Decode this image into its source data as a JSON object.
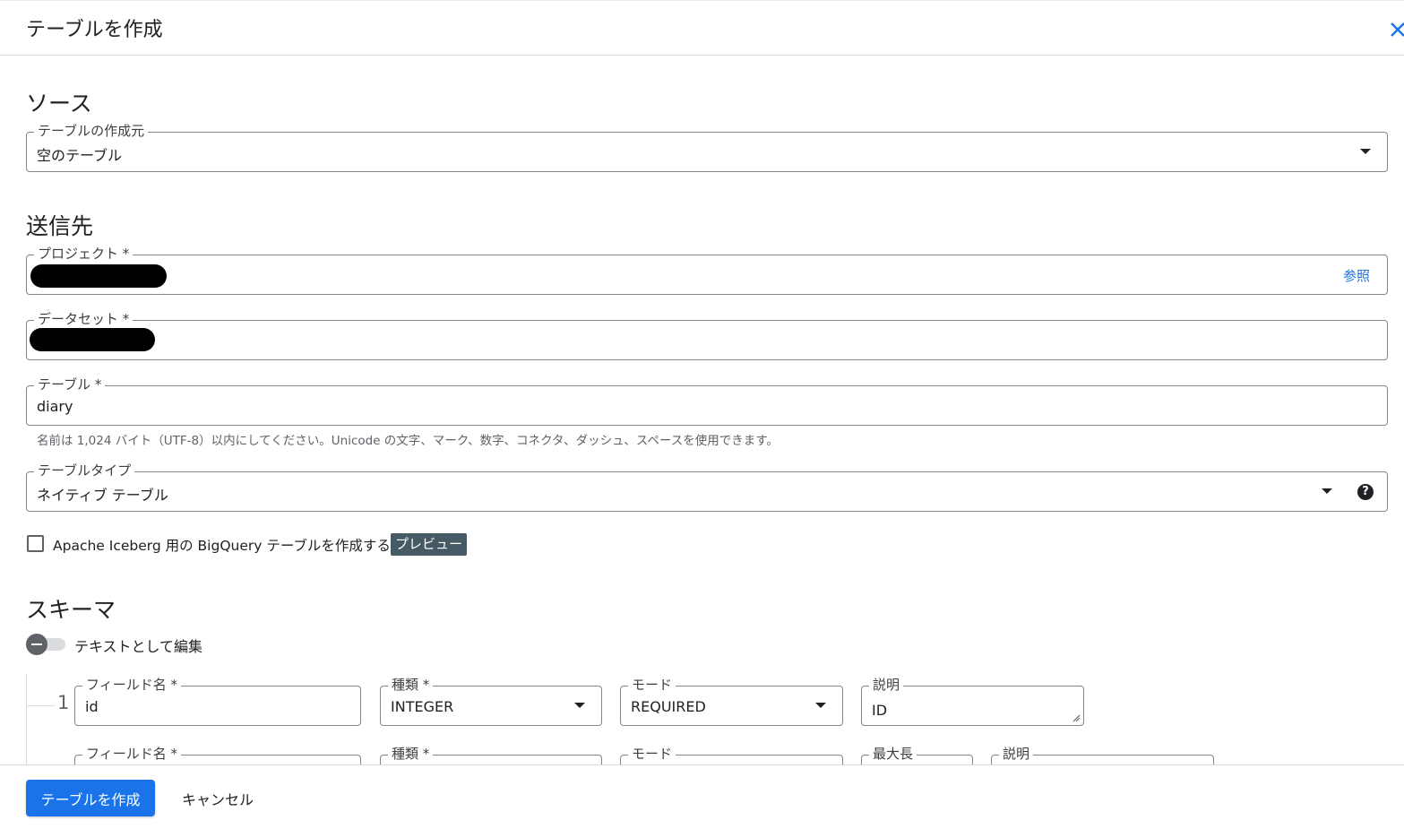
{
  "header": {
    "title": "テーブルを作成",
    "close_icon": "close-icon"
  },
  "source": {
    "section_title": "ソース",
    "create_from": {
      "label": "テーブルの作成元",
      "value": "空のテーブル"
    }
  },
  "destination": {
    "section_title": "送信先",
    "project": {
      "label": "プロジェクト *",
      "value": "",
      "browse_label": "参照"
    },
    "dataset": {
      "label": "データセット *",
      "value": ""
    },
    "table": {
      "label": "テーブル *",
      "value": "diary",
      "hint": "名前は 1,024 バイト（UTF-8）以内にしてください。Unicode の文字、マーク、数字、コネクタ、ダッシュ、スペースを使用できます。"
    },
    "table_type": {
      "label": "テーブルタイプ",
      "value": "ネイティブ テーブル",
      "help_icon": "help-icon"
    },
    "iceberg": {
      "checked": false,
      "label": "Apache Iceberg 用の BigQuery テーブルを作成する",
      "badge": "プレビュー"
    }
  },
  "schema": {
    "section_title": "スキーマ",
    "edit_as_text": {
      "enabled": false,
      "label": "テキストとして編集"
    },
    "rows": [
      {
        "number": "1",
        "field_name": {
          "label": "フィールド名 *",
          "value": "id"
        },
        "type": {
          "label": "種類 *",
          "value": "INTEGER"
        },
        "mode": {
          "label": "モード",
          "value": "REQUIRED"
        },
        "description": {
          "label": "説明",
          "value": "ID"
        }
      },
      {
        "number": "",
        "field_name": {
          "label": "フィールド名 *",
          "value": ""
        },
        "type": {
          "label": "種類 *",
          "value": ""
        },
        "mode": {
          "label": "モード",
          "value": ""
        },
        "max_length": {
          "label": "最大長",
          "value": ""
        },
        "description": {
          "label": "説明",
          "value": ""
        }
      }
    ]
  },
  "footer": {
    "create_label": "テーブルを作成",
    "cancel_label": "キャンセル"
  },
  "colors": {
    "primary": "#1a73e8",
    "badge": "#455a64",
    "border": "#80868b"
  }
}
